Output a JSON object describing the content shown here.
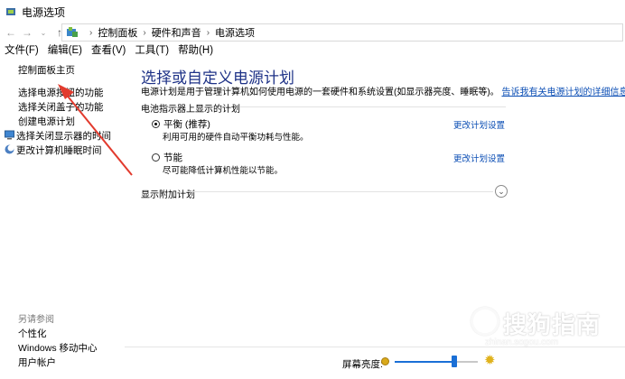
{
  "window": {
    "title": "电源选项"
  },
  "address": {
    "crumbs": [
      "控制面板",
      "硬件和声音",
      "电源选项"
    ]
  },
  "menu": {
    "items": [
      "文件(F)",
      "编辑(E)",
      "查看(V)",
      "工具(T)",
      "帮助(H)"
    ]
  },
  "sidebar": {
    "home": "控制面板主页",
    "items": [
      "选择电源按钮的功能",
      "选择关闭盖子的功能",
      "创建电源计划",
      "选择关闭显示器的时间",
      "更改计算机睡眠时间"
    ],
    "see_also_label": "另请参阅",
    "see_also": [
      "个性化",
      "Windows 移动中心",
      "用户帐户"
    ]
  },
  "main": {
    "heading": "选择或自定义电源计划",
    "description": "电源计划是用于管理计算机如何使用电源的一套硬件和系统设置(如显示器亮度、睡眠等)。",
    "description_link": "告诉我有关电源计划的详细信息",
    "section_label": "电池指示器上显示的计划",
    "plans": [
      {
        "name": "平衡 (推荐)",
        "desc": "利用可用的硬件自动平衡功耗与性能。",
        "link": "更改计划设置",
        "selected": true
      },
      {
        "name": "节能",
        "desc": "尽可能降低计算机性能以节能。",
        "link": "更改计划设置",
        "selected": false
      }
    ],
    "extra_plans_label": "显示附加计划"
  },
  "footer": {
    "brightness_label": "屏幕亮度:",
    "brightness_level": 0.72
  },
  "watermark": {
    "text": "搜狗指南",
    "url": "zhinan.sogou.com"
  },
  "colors": {
    "heading": "#1e3287",
    "link": "#0a4db4",
    "annotation_arrow": "#e23b2e",
    "slider": "#1a6fd6"
  }
}
